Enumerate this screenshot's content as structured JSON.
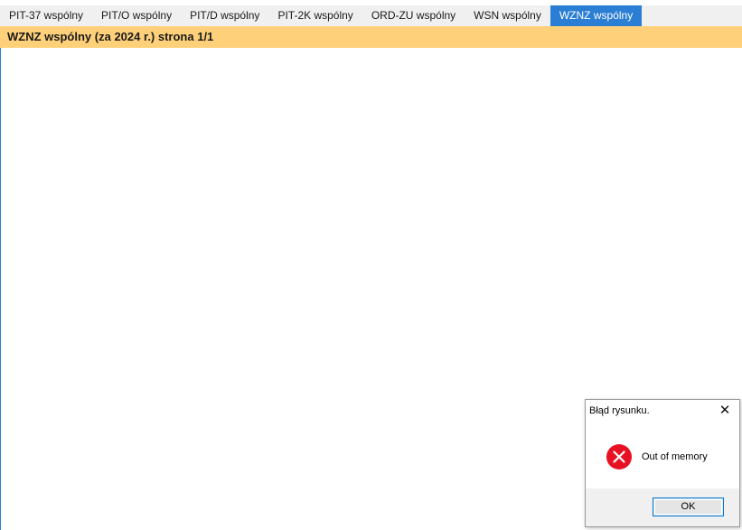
{
  "tabs": [
    {
      "label": "PIT-37 wspólny",
      "active": false
    },
    {
      "label": "PIT/O wspólny",
      "active": false
    },
    {
      "label": "PIT/D wspólny",
      "active": false
    },
    {
      "label": "PIT-2K wspólny",
      "active": false
    },
    {
      "label": "ORD-ZU wspólny",
      "active": false
    },
    {
      "label": "WSN wspólny",
      "active": false
    },
    {
      "label": "WZNZ wspólny",
      "active": true
    }
  ],
  "form": {
    "title": "WZNZ wspólny (za 2024 r.) strona 1/1"
  },
  "dialog": {
    "title": "Błąd rysunku.",
    "message": "Out of memory",
    "icon": "error-icon",
    "ok_label": "OK",
    "close_icon": "close-icon"
  },
  "colors": {
    "active_tab": "#2a7ed3",
    "title_bar": "#ffd07a",
    "error_red": "#e81123"
  }
}
